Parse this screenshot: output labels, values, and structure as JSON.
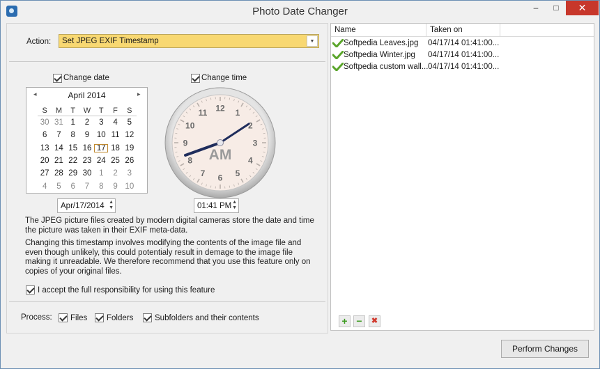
{
  "window": {
    "title": "Photo Date Changer",
    "minimize": "–",
    "maximize": "□",
    "close": "✕"
  },
  "action": {
    "label": "Action:",
    "value": "Set JPEG EXIF Timestamp"
  },
  "date_section": {
    "checkbox_label": "Change date",
    "calendar": {
      "month_label": "April 2014",
      "prev": "◂",
      "next": "▸",
      "weekdays": [
        "S",
        "M",
        "T",
        "W",
        "T",
        "F",
        "S"
      ],
      "weeks": [
        [
          "30",
          "31",
          "1",
          "2",
          "3",
          "4",
          "5"
        ],
        [
          "6",
          "7",
          "8",
          "9",
          "10",
          "11",
          "12"
        ],
        [
          "13",
          "14",
          "15",
          "16",
          "17",
          "18",
          "19"
        ],
        [
          "20",
          "21",
          "22",
          "23",
          "24",
          "25",
          "26"
        ],
        [
          "27",
          "28",
          "29",
          "30",
          "1",
          "2",
          "3"
        ],
        [
          "4",
          "5",
          "6",
          "7",
          "8",
          "9",
          "10"
        ]
      ],
      "selected_day": "17"
    },
    "date_value": "Apr/17/2014"
  },
  "time_section": {
    "checkbox_label": "Change time",
    "clock_numbers": [
      "12",
      "1",
      "2",
      "3",
      "4",
      "5",
      "6",
      "7",
      "8",
      "9",
      "10",
      "11"
    ],
    "clock_period": "AM",
    "time_value": "01:41 PM"
  },
  "info": {
    "paragraph1": "The JPEG picture files created by modern digital cameras store the date and time the picture was taken in their EXIF meta-data.",
    "paragraph2": "Changing this timestamp involves modifying the contents of the image file and even though unlikely, this could potentialy result in demage to the image file making it unreadable. We therefore recommend that you use this feature only on copies of your original files."
  },
  "accept": {
    "label": "I accept the full responsibility for using this feature"
  },
  "process": {
    "label": "Process:",
    "options": [
      "Files",
      "Folders",
      "Subfolders and their contents"
    ]
  },
  "file_list": {
    "columns": [
      "Name",
      "Taken on"
    ],
    "rows": [
      {
        "name": "Softpedia Leaves.jpg",
        "taken_on": "04/17/14 01:41:00..."
      },
      {
        "name": "Softpedia Winter.jpg",
        "taken_on": "04/17/14 01:41:00..."
      },
      {
        "name": "Softpedia custom wall...",
        "taken_on": "04/17/14 01:41:00..."
      }
    ]
  },
  "list_buttons": {
    "add": "+",
    "remove": "−",
    "clear": "✖"
  },
  "perform_button": "Perform Changes",
  "colors": {
    "action_highlight": "#f8d872",
    "check_green": "#5aa52a",
    "clock_face": "#f7ece6",
    "clock_hands": "#1f2d5c"
  }
}
